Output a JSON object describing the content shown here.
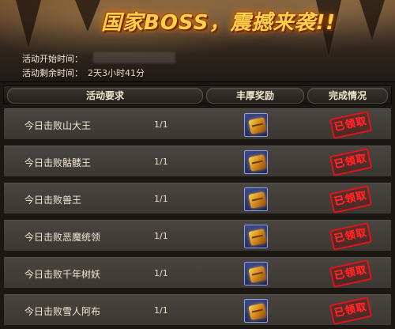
{
  "banner": {
    "title": "国家BOSS，震撼来袭!!",
    "start_label": "活动开始时间：",
    "start_value": "",
    "remaining_label": "活动剩余时间：",
    "remaining_value": "2天3小时41分"
  },
  "table": {
    "headers": {
      "requirement": "活动要求",
      "reward": "丰厚奖励",
      "status": "完成情况"
    },
    "stamp_text": "已领取",
    "rows": [
      {
        "name": "今日击败山大王",
        "progress": "1/1"
      },
      {
        "name": "今日击败骷髅王",
        "progress": "1/1"
      },
      {
        "name": "今日击败兽王",
        "progress": "1/1"
      },
      {
        "name": "今日击败恶魔统领",
        "progress": "1/1"
      },
      {
        "name": "今日击败千年树妖",
        "progress": "1/1"
      },
      {
        "name": "今日击败雪人阿布",
        "progress": "1/1"
      }
    ]
  },
  "icons": {
    "reward": "treasure-chest-icon",
    "status": "claimed-stamp"
  },
  "colors": {
    "title": "#ffd14a",
    "stamp": "#e0141a",
    "row_bg": "#423d38",
    "reward_bg": "#2b3672"
  }
}
